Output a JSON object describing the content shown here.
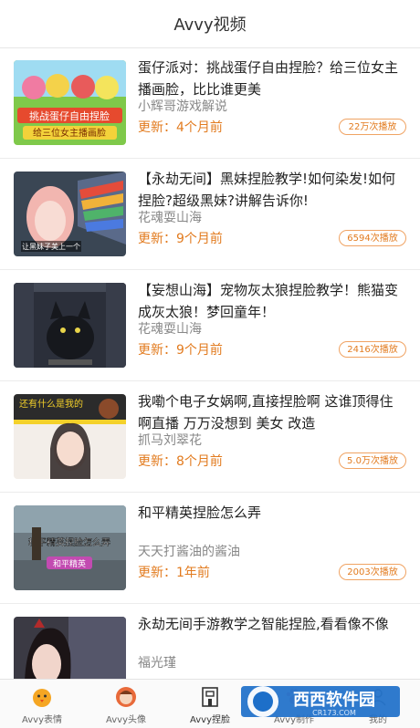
{
  "header": {
    "title": "Avvy视频"
  },
  "videos": [
    {
      "title": "蛋仔派对：挑战蛋仔自由捏脸？给三位女主播画脸，比比谁更美",
      "author": "小辉哥游戏解说",
      "update": "更新：4个月前",
      "plays": "22万次播放",
      "thumb_text_1": "挑战蛋仔自由捏脸",
      "thumb_text_2": "给三位女主播画脸"
    },
    {
      "title": "【永劫无间】黑妹捏脸教学!如何染发!如何捏脸?超级黑妹?讲解告诉你!",
      "author": "花魂耍山海",
      "update": "更新：9个月前",
      "plays": "6594次播放",
      "thumb_text_1": "让黑妹子美上一个"
    },
    {
      "title": "【妄想山海】宠物灰太狼捏脸教学！熊猫变成灰太狼！梦回童年！",
      "author": "花魂耍山海",
      "update": "更新：9个月前",
      "plays": "2416次播放"
    },
    {
      "title": "我嘞个电子女娲啊,直接捏脸啊 这谁顶得住啊直播 万万没想到 美女 改造",
      "author": "抓马刘翠花",
      "update": "更新：8个月前",
      "plays": "5.0万次播放",
      "thumb_text_1": "还有什么是我的"
    },
    {
      "title": "和平精英捏脸怎么弄",
      "author": "天天打酱油的酱油",
      "update": "更新：1年前",
      "plays": "2003次播放",
      "thumb_text_1": "和平精英捏脸怎么弄",
      "thumb_text_2": "和平精英"
    },
    {
      "title": "永劫无间手游教学之智能捏脸,看看像不像",
      "author": "福光瑾",
      "update": "",
      "plays": ""
    }
  ],
  "tabbar": {
    "tabs": [
      {
        "label": "Avvy表情",
        "icon": "chick-face-icon"
      },
      {
        "label": "Avvy头像",
        "icon": "avatar-face-icon"
      },
      {
        "label": "Avvy捏脸",
        "icon": "building-icon"
      },
      {
        "label": "Avvy制作",
        "icon": "paw-icon"
      },
      {
        "label": "我的",
        "icon": "person-icon"
      }
    ],
    "active_index": 2
  },
  "watermark": {
    "text": "西西软件园",
    "subtext": "CR173.COM"
  },
  "colors": {
    "accent": "#e27b1f",
    "badge_border": "#f0a363",
    "title_text": "#222222",
    "muted": "#888888"
  }
}
